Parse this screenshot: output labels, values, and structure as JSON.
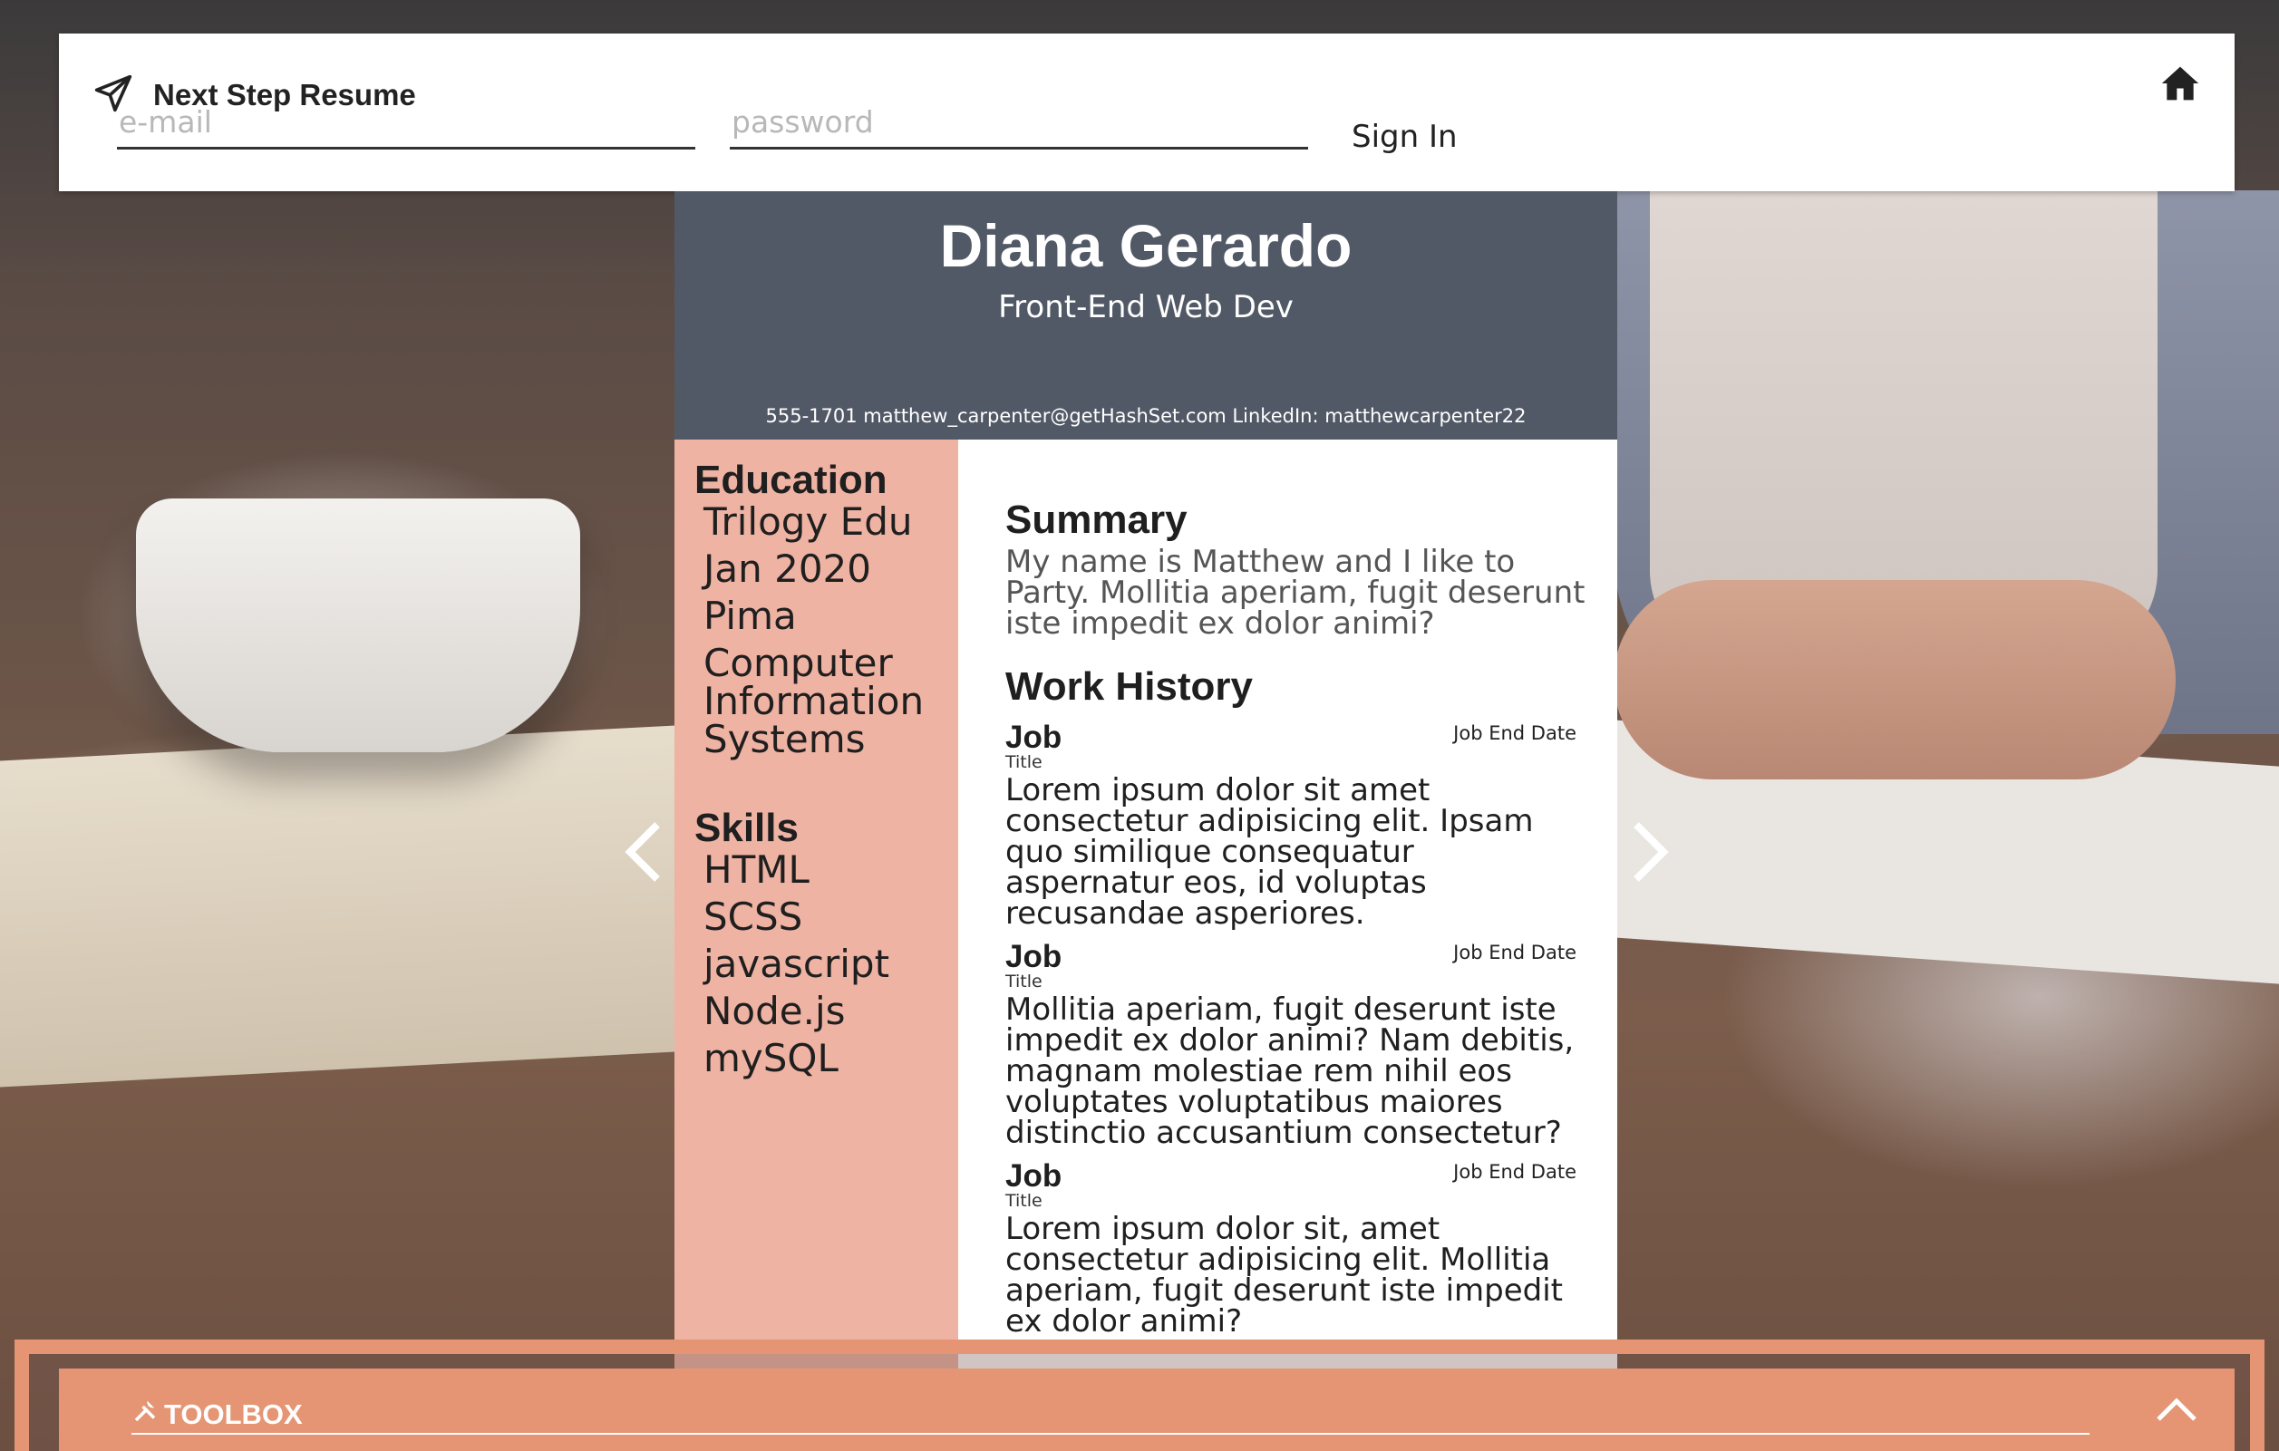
{
  "header": {
    "brand_icon": "paper-plane-icon",
    "brand_name": "Next Step Resume",
    "email_placeholder": "e-mail",
    "password_placeholder": "password",
    "signin_label": "Sign In",
    "home_icon": "home-icon"
  },
  "resume": {
    "name": "Diana Gerardo",
    "role": "Front-End Web Dev",
    "contact": "555-1701 matthew_carpenter@getHashSet.com LinkedIn: matthewcarpenter22",
    "education": {
      "title": "Education",
      "items": [
        "Trilogy Edu",
        "Jan 2020",
        "Pima",
        "Computer Information Systems"
      ]
    },
    "skills": {
      "title": "Skills",
      "items": [
        "HTML",
        "SCSS",
        "javascript",
        "Node.js",
        "mySQL"
      ]
    },
    "summary": {
      "title": "Summary",
      "text": "My name is Matthew and I like to Party. Mollitia aperiam, fugit deserunt iste impedit ex dolor animi?"
    },
    "work": {
      "title": "Work History",
      "jobs": [
        {
          "title": "Job",
          "subtitle": "Title",
          "end_date": "Job End Date",
          "desc": "Lorem ipsum dolor sit amet consectetur adipisicing elit. Ipsam quo similique consequatur aspernatur eos, id voluptas recusandae asperiores."
        },
        {
          "title": "Job",
          "subtitle": "Title",
          "end_date": "Job End Date",
          "desc": "Mollitia aperiam, fugit deserunt iste impedit ex dolor animi? Nam debitis, magnam molestiae rem nihil eos voluptates voluptatibus maiores distinctio accusantium consectetur?"
        },
        {
          "title": "Job",
          "subtitle": "Title",
          "end_date": "Job End Date",
          "desc": "Lorem ipsum dolor sit, amet consectetur adipisicing elit. Mollitia aperiam, fugit deserunt iste impedit ex dolor animi?"
        }
      ]
    }
  },
  "carousel": {
    "prev_icon": "chevron-left-icon",
    "next_icon": "chevron-right-icon"
  },
  "toolbox": {
    "icon": "tools-icon",
    "label": "TOOLBOX",
    "toggle_icon": "chevron-up-icon"
  },
  "colors": {
    "header_bg": "#ffffff",
    "resume_head": "#525966",
    "resume_left": "#efb3a3",
    "toolbox": "#e59574"
  }
}
